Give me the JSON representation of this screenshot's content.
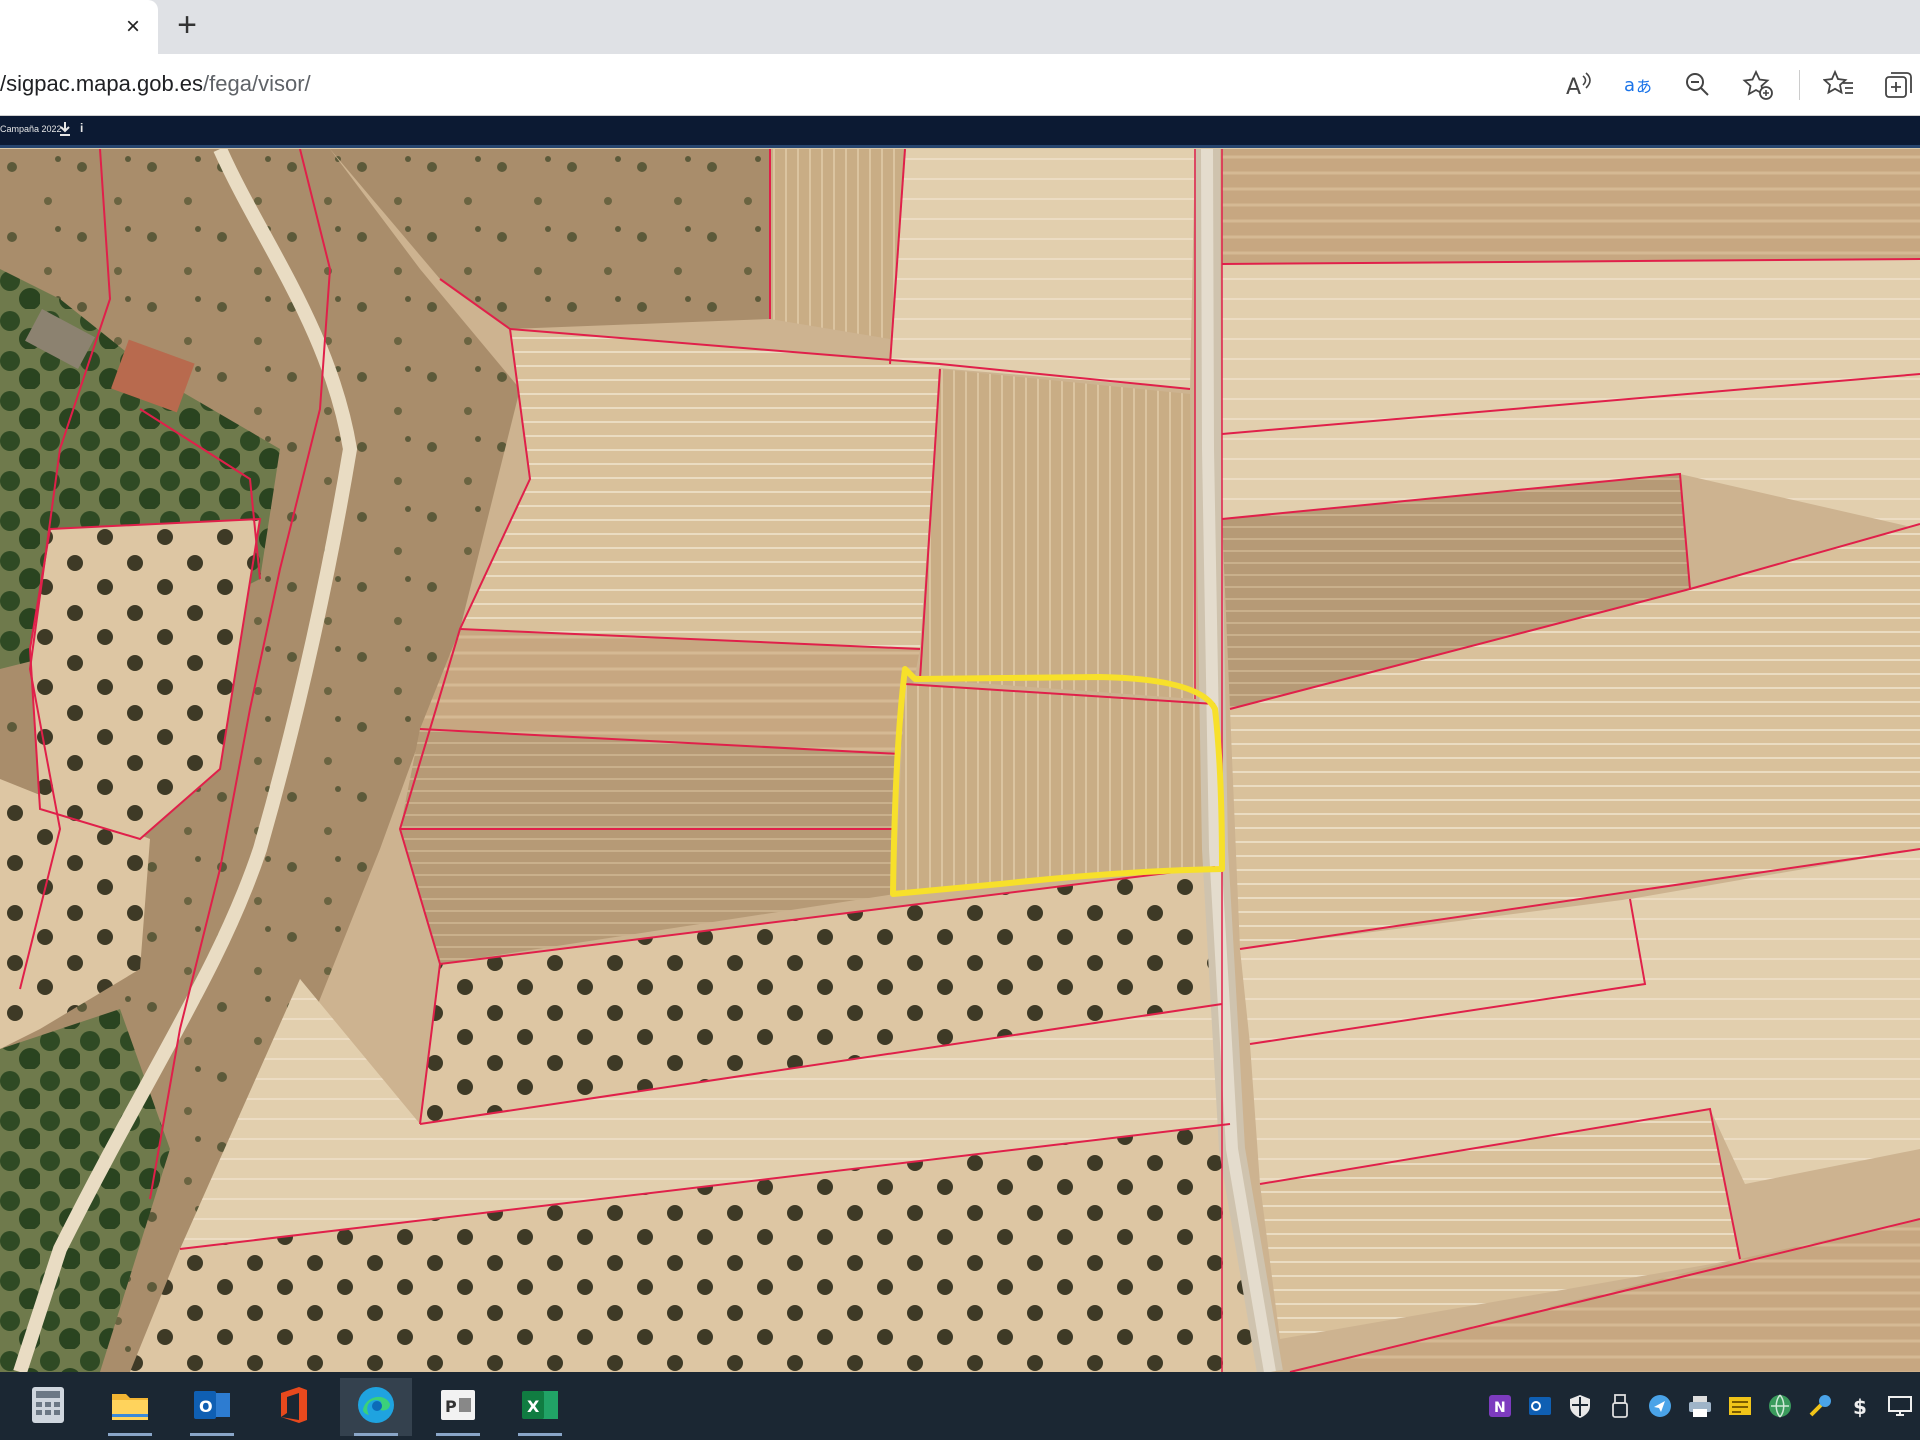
{
  "browser": {
    "tab": {
      "close_glyph": "×"
    },
    "new_tab_glyph": "+",
    "address": {
      "host": "sigpac.mapa.gob.es",
      "path": "/fega/visor/",
      "prefix": "/"
    },
    "toolbar_icons": [
      "read-aloud-icon",
      "translate-icon",
      "zoom-out-icon",
      "add-favorite-icon",
      "favorites-icon",
      "collections-icon"
    ]
  },
  "app_bar": {
    "campaign_label": "Campaña 2022",
    "download_icon": "download-icon",
    "info_label": "i"
  },
  "map": {
    "view": "aerial orthophoto with parcel boundaries",
    "boundary_color": "#e0204a",
    "highlight_color": "#f7e02a"
  },
  "taskbar": {
    "apps": [
      {
        "name": "calculator",
        "icon": "calculator-icon"
      },
      {
        "name": "file-explorer",
        "icon": "folder-icon"
      },
      {
        "name": "outlook",
        "icon": "outlook-icon",
        "text": "O"
      },
      {
        "name": "office",
        "icon": "office-icon"
      },
      {
        "name": "edge",
        "icon": "edge-icon",
        "active": true
      },
      {
        "name": "app-pdf",
        "icon": "document-app-icon",
        "text": "P"
      },
      {
        "name": "excel",
        "icon": "excel-icon",
        "text": "X"
      }
    ],
    "tray": [
      "onenote-icon",
      "outlook-tray-icon",
      "security-icon",
      "usb-icon",
      "share-icon",
      "printer-icon",
      "app-tray-icon",
      "network-icon",
      "tools-icon",
      "dollar-icon",
      "display-icon"
    ],
    "onenote_text": "N",
    "dollar_text": "$"
  }
}
